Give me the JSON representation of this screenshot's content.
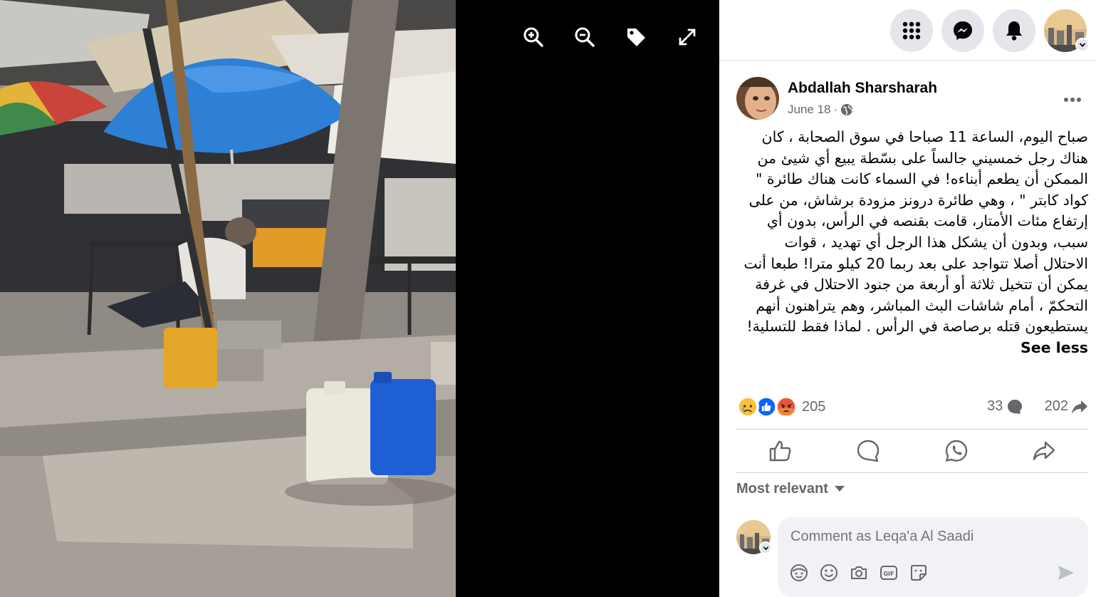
{
  "viewer": {
    "buttons": [
      "zoom-in",
      "zoom-out",
      "tag",
      "fullscreen"
    ],
    "photo_alt": "Street market scene with blue umbrella and water jerrycans"
  },
  "topbar": {
    "icons": [
      "menu-grid-icon",
      "messenger-icon",
      "notifications-icon",
      "account-avatar"
    ]
  },
  "post": {
    "author": "Abdallah Sharsharah",
    "date": "June 18",
    "date_sep": "·",
    "text": "صباح اليوم، الساعة 11 صباحا في سوق الصحابة ، كان هناك رجل خمسيني جالساً على بسّطة يبيع أي شيئ من الممكن أن يطعم أبناءه! في السماء كانت هناك طائرة \" كواد كابتر \" ، وهي طائرة درونز مزودة برشاش، من على إرتفاع مئات الأمتار، قامت بقنصه في الرأس، بدون أي سبب، وبدون أن يشكل هذا الرجل أي تهديد ، قوات الاحتلال أصلا تتواجد على بعد ربما 20 كيلو مترا! طبعا أنت يمكن أن تتخيل ثلاثة أو أربعة من جنود الاحتلال في غرفة التحكمّ ، أمام شاشات البث المباشر، وهم يتراهنون أنهم يستطيعون قتله برصاصة في الرأس . لماذا فقط للتسلية!",
    "see_less": "See less",
    "reaction_count": "205",
    "comment_count": "33",
    "share_count": "202"
  },
  "comments": {
    "sort_label": "Most relevant",
    "composer_placeholder": "Comment as Leqa'a Al Saadi"
  },
  "colors": {
    "accent": "#0866ff",
    "secondary_text": "#65676b",
    "button_bg": "#e4e6eb"
  }
}
